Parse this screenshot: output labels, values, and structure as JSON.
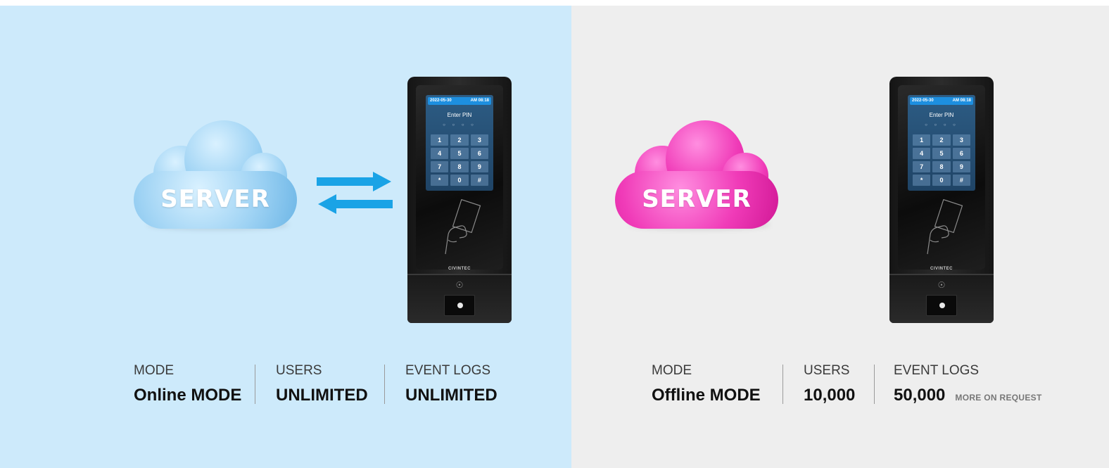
{
  "online": {
    "server_label": "SERVER",
    "device": {
      "date": "2022-05-30",
      "time": "AM 08:18",
      "prompt": "Enter PIN",
      "pin_dots": "○ ○ ○ ○",
      "keys": [
        "1",
        "2",
        "3",
        "4",
        "5",
        "6",
        "7",
        "8",
        "9",
        "*",
        "0",
        "#"
      ],
      "brand": "CIVINTEC"
    },
    "stats": {
      "mode_label": "MODE",
      "mode_value": "Online MODE",
      "users_label": "USERS",
      "users_value": "UNLIMITED",
      "logs_label": "EVENT LOGS",
      "logs_value": "UNLIMITED"
    },
    "cloud_color": "#8fcaf0",
    "arrow_color": "#1aa3e6",
    "background": "#cdeafb"
  },
  "offline": {
    "server_label": "SERVER",
    "device": {
      "date": "2022-05-30",
      "time": "AM 08:18",
      "prompt": "Enter PIN",
      "pin_dots": "○ ○ ○ ○",
      "keys": [
        "1",
        "2",
        "3",
        "4",
        "5",
        "6",
        "7",
        "8",
        "9",
        "*",
        "0",
        "#"
      ],
      "brand": "CIVINTEC"
    },
    "stats": {
      "mode_label": "MODE",
      "mode_value": "Offline MODE",
      "users_label": "USERS",
      "users_value": "10,000",
      "logs_label": "EVENT LOGS",
      "logs_value": "50,000",
      "logs_note": "MORE ON REQUEST"
    },
    "cloud_color": "#f03bb8",
    "background": "#eeeeee"
  }
}
